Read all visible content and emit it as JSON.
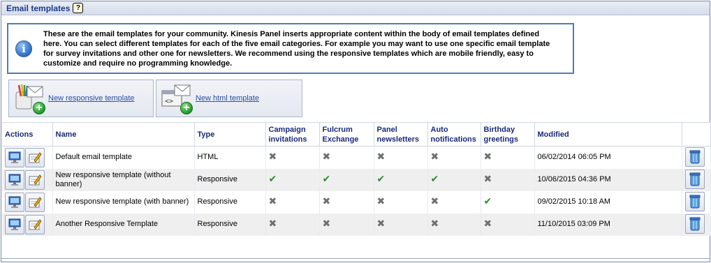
{
  "panel": {
    "title": "Email templates",
    "help_label": "?"
  },
  "info": {
    "text": "These are the email templates for your community. Kinesis Panel inserts appropriate content within the body of email templates defined here. You can select different templates for each of the five email categories. For example you may want to use one specific email template for survey invitations and other one for newsletters. We recommend using the responsive templates which are mobile friendly, easy to customize and require no programming knowledge.",
    "icon_glyph": "i"
  },
  "actions": {
    "new_responsive_label": "New responsive template",
    "new_html_label": "New html template"
  },
  "table": {
    "headers": {
      "actions": "Actions",
      "name": "Name",
      "type": "Type",
      "campaign_1": "Campaign",
      "campaign_2": "invitations",
      "fulcrum_1": "Fulcrum",
      "fulcrum_2": "Exchange",
      "panel_1": "Panel",
      "panel_2": "newsletters",
      "auto_1": "Auto",
      "auto_2": "notifications",
      "birthday_1": "Birthday",
      "birthday_2": "greetings",
      "modified": "Modified"
    },
    "rows": [
      {
        "name": "Default email template",
        "type": "HTML",
        "campaign": "no",
        "fulcrum": "no",
        "panel": "no",
        "auto": "no",
        "birthday": "no",
        "modified": "06/02/2014 06:05 PM"
      },
      {
        "name": "New responsive template (without banner)",
        "type": "Responsive",
        "campaign": "yes",
        "fulcrum": "yes",
        "panel": "yes",
        "auto": "yes",
        "birthday": "no",
        "modified": "10/06/2015 04:36 PM"
      },
      {
        "name": "New responsive template (with banner)",
        "type": "Responsive",
        "campaign": "no",
        "fulcrum": "no",
        "panel": "no",
        "auto": "no",
        "birthday": "yes",
        "modified": "09/02/2015 10:18 AM"
      },
      {
        "name": "Another Responsive Template",
        "type": "Responsive",
        "campaign": "no",
        "fulcrum": "no",
        "panel": "no",
        "auto": "no",
        "birthday": "no",
        "modified": "11/10/2015 03:09 PM"
      }
    ]
  },
  "colors": {
    "header_text": "#1a2a7a",
    "link": "#2a4fa0",
    "check": "#2e8b2e",
    "cross": "#707070",
    "info_border": "#4f7bb5"
  },
  "icons": {
    "preview": "monitor-icon",
    "edit": "edit-pencil-icon",
    "delete": "trash-can-icon",
    "enabled": "check-icon",
    "disabled": "cross-icon"
  }
}
